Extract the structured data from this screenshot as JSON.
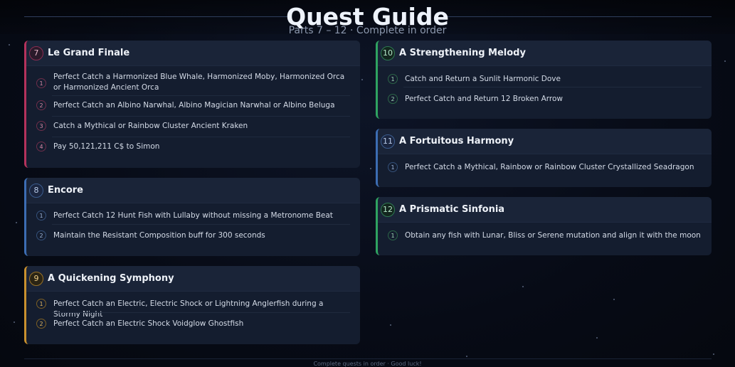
{
  "header": {
    "title": "Quest Guide",
    "subtitle": "Parts 7 – 12 · Complete in order"
  },
  "quests": [
    {
      "number": "7",
      "title": "Le Grand Finale",
      "accent": "#b5325c",
      "tasks": [
        {
          "num": "1",
          "text": "Perfect Catch a Harmonized Blue Whale, Harmonized Moby, Harmonized Orca or Harmonized Ancient Orca"
        },
        {
          "num": "2",
          "text": "Perfect Catch an Albino Narwhal, Albino Magician Narwhal or Albino Beluga"
        },
        {
          "num": "3",
          "text": "Catch a Mythical or Rainbow Cluster Ancient Kraken"
        },
        {
          "num": "4",
          "text": "Pay 50,121,211 C$ to Simon"
        }
      ]
    },
    {
      "number": "8",
      "title": "Encore",
      "accent": "#3c6db3",
      "tasks": [
        {
          "num": "1",
          "text": "Perfect Catch 12 Hunt Fish with Lullaby without missing a Metronome Beat"
        },
        {
          "num": "2",
          "text": "Maintain the Resistant Composition buff for 300 seconds"
        }
      ]
    },
    {
      "number": "9",
      "title": "A Quickening Symphony",
      "accent": "#c8902e",
      "tasks": [
        {
          "num": "1",
          "text": "Perfect Catch an Electric, Electric Shock or Lightning Anglerfish during a Stormy Night"
        },
        {
          "num": "2",
          "text": "Perfect Catch an Electric Shock Voidglow Ghostfish"
        }
      ]
    },
    {
      "number": "10",
      "title": "A Strengthening Melody",
      "accent": "#2fa361",
      "tasks": [
        {
          "num": "1",
          "text": "Catch and Return a Sunlit Harmonic Dove"
        },
        {
          "num": "2",
          "text": "Perfect Catch and Return 12 Broken Arrow"
        }
      ]
    },
    {
      "number": "11",
      "title": "A Fortuitous Harmony",
      "accent": "#3c6db3",
      "tasks": [
        {
          "num": "1",
          "text": "Perfect Catch a Mythical, Rainbow or Rainbow Cluster Crystallized Seadragon"
        }
      ]
    },
    {
      "number": "12",
      "title": "A Prismatic Sinfonia",
      "accent": "#2fa361",
      "tasks": [
        {
          "num": "1",
          "text": "Obtain any fish with Lunar, Bliss or Serene mutation and align it with the moon"
        }
      ]
    }
  ],
  "footer": "Complete quests in order · Good luck!"
}
